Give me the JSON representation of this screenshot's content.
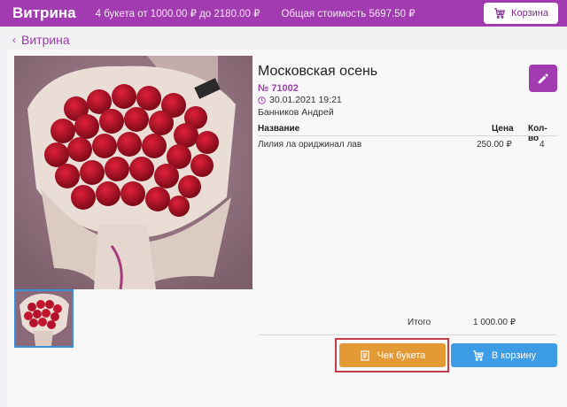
{
  "header": {
    "brand": "Витрина",
    "bouquets_range": "4 букета от 1000.00 ₽ до 2180.00 ₽",
    "total_cost": "Общая стоимость 5697.50 ₽",
    "cart_label": "Корзина",
    "background": "#a33bb0"
  },
  "breadcrumb": {
    "back_label": "Витрина",
    "icon": "chevron-left-icon"
  },
  "bouquet": {
    "title": "Московская осень",
    "number": "№ 71002",
    "date": "30.01.2021 19:21",
    "author": "Банников Андрей",
    "image": "red-roses-bouquet-photo"
  },
  "composition": {
    "columns": {
      "name": "Название",
      "price": "Цена",
      "qty": "Кол-во"
    },
    "rows": [
      {
        "name": "Лилия ла ориджинал лав",
        "price": "250.00 ₽",
        "qty": "4"
      }
    ],
    "total_label": "Итого",
    "total_value": "1 000.00 ₽"
  },
  "actions": {
    "receipt_label": "Чек букета",
    "add_to_cart_label": "В корзину",
    "receipt_color": "#e49a34",
    "add_to_cart_color": "#3d9ce6",
    "highlight_color": "#c53d4b"
  }
}
